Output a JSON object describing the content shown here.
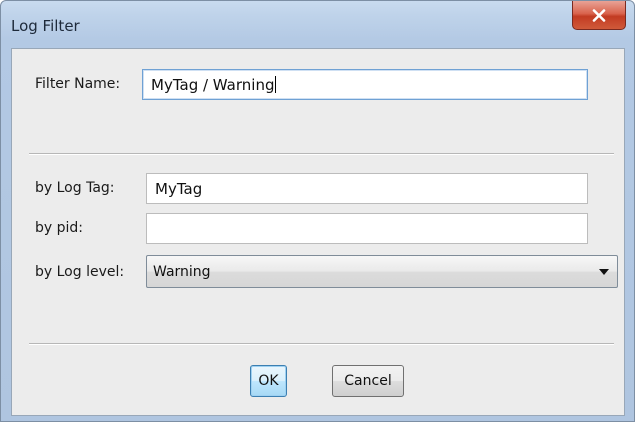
{
  "window": {
    "title": "Log Filter"
  },
  "filter": {
    "name_label": "Filter Name:",
    "name_value": "MyTag / Warning"
  },
  "criteria": {
    "tag_label": "by Log Tag:",
    "tag_value": "MyTag",
    "pid_label": "by pid:",
    "pid_value": "",
    "level_label": "by Log level:",
    "level_value": "Warning"
  },
  "buttons": {
    "ok_label": "OK",
    "cancel_label": "Cancel"
  }
}
